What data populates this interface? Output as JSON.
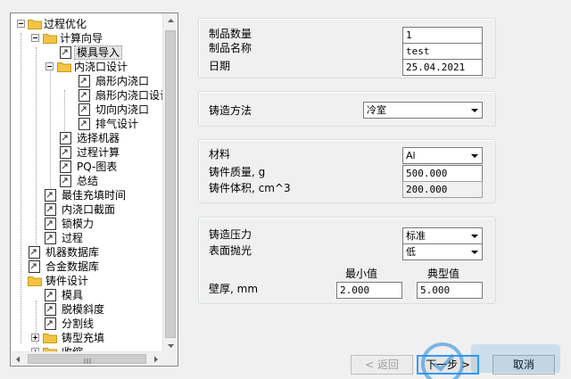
{
  "tree": {
    "items": [
      {
        "label": "过程优化"
      },
      {
        "label": "计算向导"
      },
      {
        "label": "模具导入"
      },
      {
        "label": "内浇口设计"
      },
      {
        "label": "扇形内浇口"
      },
      {
        "label": "扇形内浇口设计"
      },
      {
        "label": "切向内浇口"
      },
      {
        "label": "排气设计"
      },
      {
        "label": "选择机器"
      },
      {
        "label": "过程计算"
      },
      {
        "label": "PQ-图表"
      },
      {
        "label": "总结"
      },
      {
        "label": "最佳充填时间"
      },
      {
        "label": "内浇口截面"
      },
      {
        "label": "锁模力"
      },
      {
        "label": "过程"
      },
      {
        "label": "机器数据库"
      },
      {
        "label": "合金数据库"
      },
      {
        "label": "铸件设计"
      },
      {
        "label": "模具"
      },
      {
        "label": "脱模斜度"
      },
      {
        "label": "分割线"
      },
      {
        "label": "铸型充填"
      },
      {
        "label": "收缩"
      }
    ]
  },
  "product": {
    "quantity_label": "制品数量",
    "quantity_value": "1",
    "name_label": "制品名称",
    "name_value": "test",
    "date_label": "日期",
    "date_value": "25.04.2021"
  },
  "casting": {
    "method_label": "铸造方法",
    "method_value": "冷室"
  },
  "material": {
    "material_label": "材料",
    "material_value": "Al",
    "mass_label": "铸件质量, g",
    "mass_value": "500.000",
    "volume_label": "铸件体积, cm^3",
    "volume_value": "200.000"
  },
  "process": {
    "pressure_label": "铸造压力",
    "pressure_value": "标准",
    "polish_label": "表面抛光",
    "polish_value": "低",
    "min_header": "最小值",
    "typical_header": "典型值",
    "wall_label": "壁厚, mm",
    "wall_min": "2.000",
    "wall_typical": "5.000"
  },
  "buttons": {
    "back_label": "< 返回",
    "next_label": "下一步 >",
    "cancel_label": "取消"
  },
  "colors": {
    "folder": "#f3c443",
    "accent": "#3399ff",
    "watermark": "#2f8fd8"
  }
}
